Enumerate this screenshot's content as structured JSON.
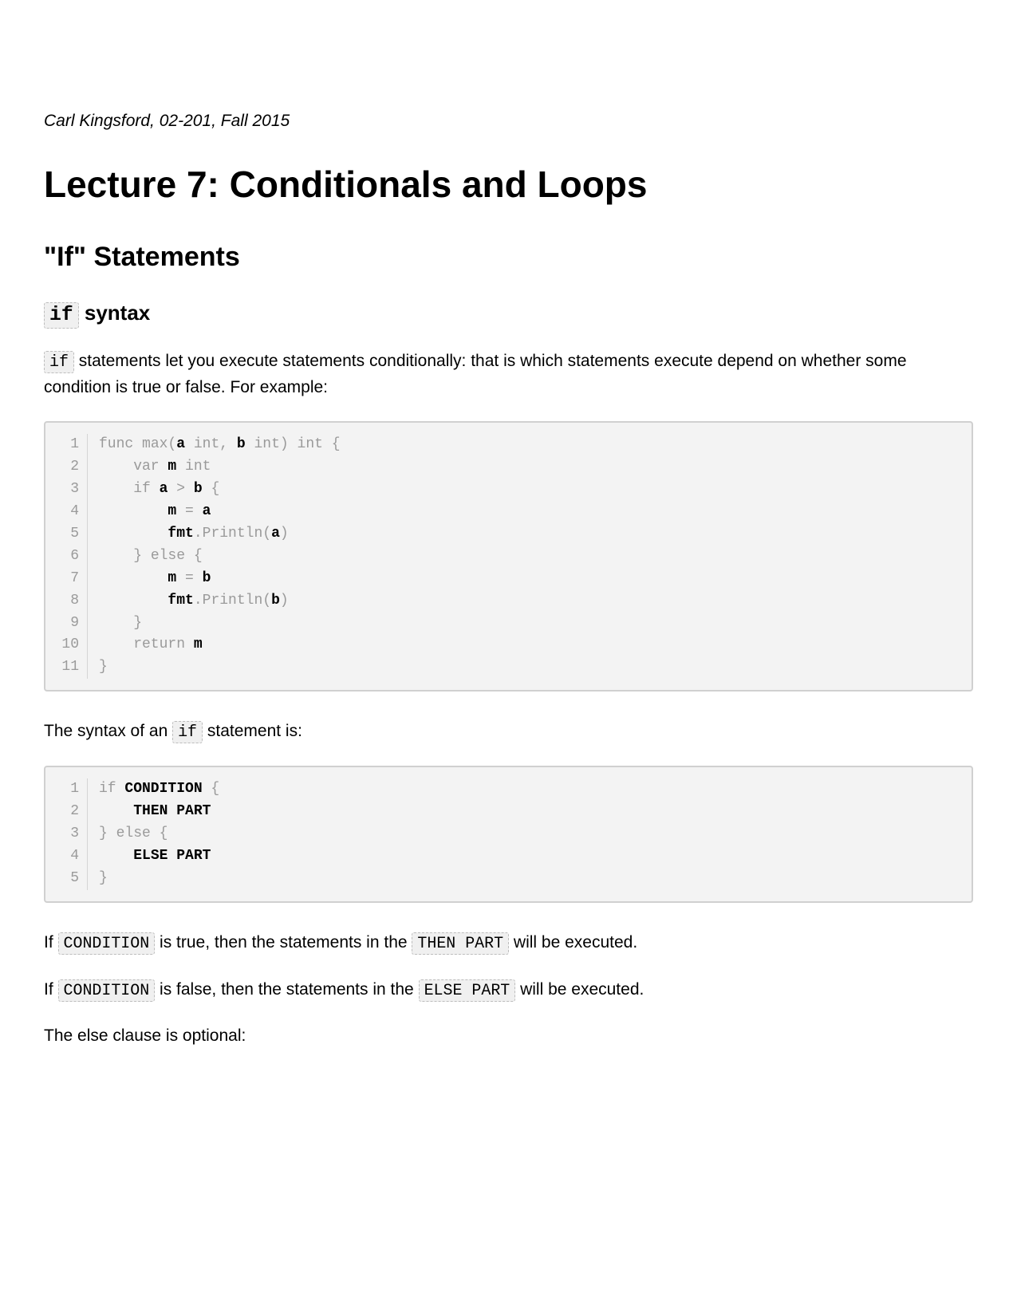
{
  "byline": "Carl Kingsford, 02-201, Fall 2015",
  "title": "Lecture 7: Conditionals and Loops",
  "section": "\"If\" Statements",
  "subsection_keyword": "if",
  "subsection_rest": " syntax",
  "p1_code": "if",
  "p1_rest": " statements let you execute statements conditionally: that is which statements execute depend on whether some condition is true or false. For example:",
  "code1": {
    "lines": [
      {
        "n": "1",
        "tokens": [
          {
            "t": "func ",
            "c": "kw"
          },
          {
            "t": "max",
            "c": "fn"
          },
          {
            "t": "(",
            "c": "punc"
          },
          {
            "t": "a",
            "c": "id"
          },
          {
            "t": " ",
            "c": "kw"
          },
          {
            "t": "int",
            "c": "kw"
          },
          {
            "t": ", ",
            "c": "punc"
          },
          {
            "t": "b",
            "c": "id"
          },
          {
            "t": " ",
            "c": "kw"
          },
          {
            "t": "int",
            "c": "kw"
          },
          {
            "t": ") ",
            "c": "punc"
          },
          {
            "t": "int",
            "c": "kw"
          },
          {
            "t": " {",
            "c": "punc"
          }
        ]
      },
      {
        "n": "2",
        "tokens": [
          {
            "t": "    var ",
            "c": "kw"
          },
          {
            "t": "m",
            "c": "id"
          },
          {
            "t": " ",
            "c": "kw"
          },
          {
            "t": "int",
            "c": "kw"
          }
        ]
      },
      {
        "n": "3",
        "tokens": [
          {
            "t": "    if ",
            "c": "kw"
          },
          {
            "t": "a",
            "c": "id"
          },
          {
            "t": " > ",
            "c": "op"
          },
          {
            "t": "b",
            "c": "id"
          },
          {
            "t": " {",
            "c": "punc"
          }
        ]
      },
      {
        "n": "4",
        "tokens": [
          {
            "t": "        ",
            "c": "punc"
          },
          {
            "t": "m",
            "c": "id"
          },
          {
            "t": " = ",
            "c": "op"
          },
          {
            "t": "a",
            "c": "id"
          }
        ]
      },
      {
        "n": "5",
        "tokens": [
          {
            "t": "        ",
            "c": "punc"
          },
          {
            "t": "fmt",
            "c": "id"
          },
          {
            "t": ".",
            "c": "punc"
          },
          {
            "t": "Println",
            "c": "fn"
          },
          {
            "t": "(",
            "c": "punc"
          },
          {
            "t": "a",
            "c": "id"
          },
          {
            "t": ")",
            "c": "punc"
          }
        ]
      },
      {
        "n": "6",
        "tokens": [
          {
            "t": "    } ",
            "c": "punc"
          },
          {
            "t": "else",
            "c": "kw"
          },
          {
            "t": " {",
            "c": "punc"
          }
        ]
      },
      {
        "n": "7",
        "tokens": [
          {
            "t": "        ",
            "c": "punc"
          },
          {
            "t": "m",
            "c": "id"
          },
          {
            "t": " = ",
            "c": "op"
          },
          {
            "t": "b",
            "c": "id"
          }
        ]
      },
      {
        "n": "8",
        "tokens": [
          {
            "t": "        ",
            "c": "punc"
          },
          {
            "t": "fmt",
            "c": "id"
          },
          {
            "t": ".",
            "c": "punc"
          },
          {
            "t": "Println",
            "c": "fn"
          },
          {
            "t": "(",
            "c": "punc"
          },
          {
            "t": "b",
            "c": "id"
          },
          {
            "t": ")",
            "c": "punc"
          }
        ]
      },
      {
        "n": "9",
        "tokens": [
          {
            "t": "    }",
            "c": "punc"
          }
        ]
      },
      {
        "n": "10",
        "tokens": [
          {
            "t": "    return ",
            "c": "kw"
          },
          {
            "t": "m",
            "c": "id"
          }
        ]
      },
      {
        "n": "11",
        "tokens": [
          {
            "t": "}",
            "c": "punc"
          }
        ]
      }
    ]
  },
  "p2_pre": "The syntax of an ",
  "p2_code": "if",
  "p2_post": " statement is:",
  "code2": {
    "lines": [
      {
        "n": "1",
        "tokens": [
          {
            "t": "if ",
            "c": "kw"
          },
          {
            "t": "CONDITION",
            "c": "upper"
          },
          {
            "t": " {",
            "c": "punc"
          }
        ]
      },
      {
        "n": "2",
        "tokens": [
          {
            "t": "    ",
            "c": "punc"
          },
          {
            "t": "THEN PART",
            "c": "upper"
          }
        ]
      },
      {
        "n": "3",
        "tokens": [
          {
            "t": "} ",
            "c": "punc"
          },
          {
            "t": "else",
            "c": "kw"
          },
          {
            "t": " {",
            "c": "punc"
          }
        ]
      },
      {
        "n": "4",
        "tokens": [
          {
            "t": "    ",
            "c": "punc"
          },
          {
            "t": "ELSE PART",
            "c": "upper"
          }
        ]
      },
      {
        "n": "5",
        "tokens": [
          {
            "t": "}",
            "c": "punc"
          }
        ]
      }
    ]
  },
  "line_a": {
    "pre": "If ",
    "c1": "CONDITION",
    "mid": " is true, then the statements in the ",
    "c2": "THEN PART",
    "post": " will be executed."
  },
  "line_b": {
    "pre": "If ",
    "c1": "CONDITION",
    "mid": " is false, then the statements in the ",
    "c2": "ELSE PART",
    "post": " will be executed."
  },
  "line_c": "The else clause is optional:"
}
